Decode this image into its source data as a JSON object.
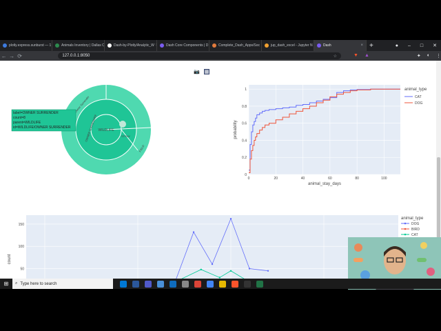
{
  "browser": {
    "tabs": [
      {
        "label": "plotly.express.sunburst — 1",
        "color": "#3d7be0"
      },
      {
        "label": "Animals Inventory | Dallas O",
        "color": "#2d8a4e"
      },
      {
        "label": "Dash-by-Plotly/Analytic_W",
        "color": "#ffffff"
      },
      {
        "label": "Dash Core Components | D",
        "color": "#7a5cf0"
      },
      {
        "label": "Complete_Dash_Apps/Soc",
        "color": "#e07a3d"
      },
      {
        "label": "jup_dash_excel - Jupyter N",
        "color": "#f0a030"
      },
      {
        "label": "Dash",
        "color": "#7a5cf0",
        "active": true
      }
    ],
    "new_tab": "+",
    "window_controls": [
      "●",
      "–",
      "□",
      "✕"
    ],
    "url": "127.0.0.1:8050",
    "nav": [
      "←",
      "→",
      "⟳"
    ]
  },
  "sunburst": {
    "center_label": "WILDLIFE",
    "ring_labels": [
      "OWNER SURRENDER",
      "STRAY",
      "FIELD"
    ],
    "outer_labels": [
      "Owner Surrender",
      "FIELD"
    ],
    "tooltip": [
      "label=OWNER SURRENDER",
      "count=8",
      "parent=WILDLIFE",
      "id=WILDLIFE/OWNER SURRENDER"
    ],
    "colors": {
      "outer": "#4fd9b0",
      "mid": "#1fc596",
      "inner": "#1fc596"
    }
  },
  "ecdf": {
    "chart_data": {
      "type": "line",
      "xlabel": "animal_stay_days",
      "ylabel": "probability",
      "xlim": [
        0,
        112
      ],
      "ylim": [
        0,
        1.05
      ],
      "xticks": [
        "0",
        "20",
        "40",
        "60",
        "80",
        "100"
      ],
      "yticks": [
        "0",
        "0.2",
        "0.4",
        "0.6",
        "0.8",
        "1"
      ],
      "legend_title": "animal_type",
      "series": [
        {
          "name": "CAT",
          "color": "#636efa",
          "x": [
            0,
            1,
            2,
            3,
            4,
            5,
            6,
            8,
            10,
            12,
            15,
            20,
            25,
            30,
            35,
            40,
            45,
            50,
            55,
            60,
            65,
            70,
            75,
            80,
            90,
            100,
            112
          ],
          "y": [
            0.05,
            0.35,
            0.5,
            0.58,
            0.62,
            0.66,
            0.7,
            0.72,
            0.74,
            0.75,
            0.76,
            0.77,
            0.78,
            0.79,
            0.81,
            0.82,
            0.84,
            0.86,
            0.88,
            0.9,
            0.96,
            0.98,
            0.99,
            0.995,
            1,
            1,
            1
          ]
        },
        {
          "name": "DOG",
          "color": "#ef553b",
          "x": [
            0,
            1,
            2,
            3,
            4,
            5,
            6,
            8,
            10,
            12,
            15,
            20,
            25,
            30,
            35,
            40,
            45,
            50,
            55,
            60,
            65,
            70,
            75,
            80,
            90,
            100,
            112
          ],
          "y": [
            0.02,
            0.18,
            0.28,
            0.34,
            0.4,
            0.44,
            0.48,
            0.52,
            0.55,
            0.58,
            0.6,
            0.64,
            0.67,
            0.71,
            0.74,
            0.77,
            0.8,
            0.84,
            0.87,
            0.91,
            0.94,
            0.96,
            0.98,
            0.99,
            1,
            1,
            1
          ]
        }
      ]
    }
  },
  "bottom_chart": {
    "chart_data": {
      "type": "line",
      "ylabel": "count",
      "yticks": [
        "50",
        "100",
        "150"
      ],
      "legend_title": "animal_type",
      "series": [
        {
          "name": "DOG",
          "color": "#636efa",
          "points": [
            [
              0,
              0
            ],
            [
              0.35,
              0
            ],
            [
              0.4,
              20
            ],
            [
              0.45,
              132
            ],
            [
              0.5,
              60
            ],
            [
              0.55,
              162
            ],
            [
              0.6,
              50
            ],
            [
              0.65,
              45
            ],
            [
              0.7,
              0
            ],
            [
              1,
              0
            ]
          ]
        },
        {
          "name": "BIRD",
          "color": "#ef553b",
          "points": [
            [
              0,
              0
            ],
            [
              1,
              0
            ]
          ]
        },
        {
          "name": "CAT",
          "color": "#00cc96",
          "points": [
            [
              0,
              0
            ],
            [
              0.4,
              20
            ],
            [
              0.47,
              48
            ],
            [
              0.52,
              30
            ],
            [
              0.55,
              45
            ],
            [
              0.6,
              20
            ],
            [
              1,
              0
            ]
          ]
        }
      ]
    }
  },
  "taskbar": {
    "search_placeholder": "Type here to search",
    "icons": [
      "#0078d4",
      "#2b579a",
      "#5059c9",
      "#4a90d9",
      "#0f6cbd",
      "#888888",
      "#db4437",
      "#4285f4",
      "#e6b800",
      "#fb542b",
      "#333333",
      "#217346"
    ]
  }
}
